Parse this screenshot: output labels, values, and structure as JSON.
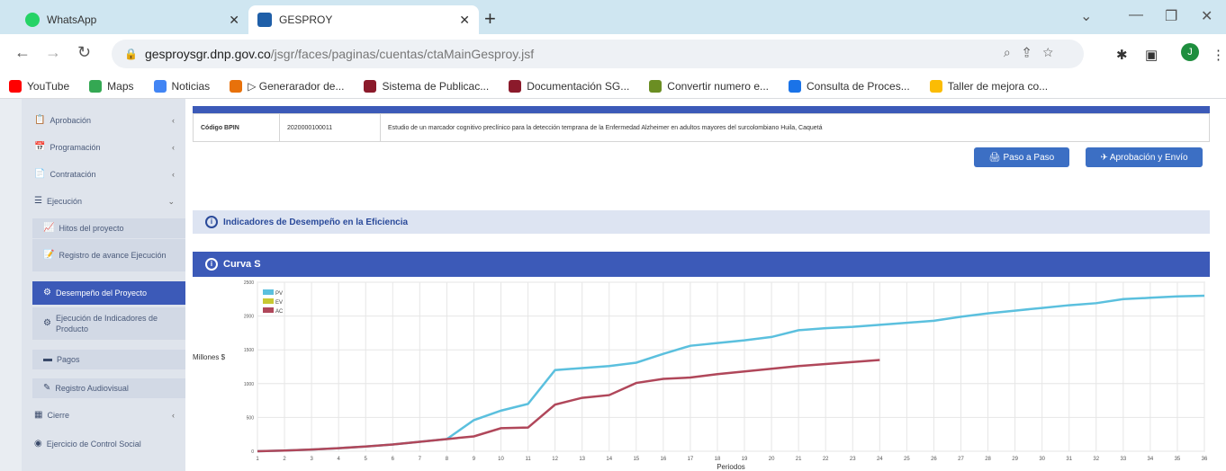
{
  "browser": {
    "tabs": [
      {
        "title": "WhatsApp",
        "color": "#25d366",
        "active": false
      },
      {
        "title": "GESPROY",
        "color": "#1f5fa8",
        "active": true
      }
    ],
    "new_tab": "+",
    "url_host": "gesproysgr.dnp.gov.co",
    "url_path": "/jsgr/faces/paginas/cuentas/ctaMainGesproy.jsf",
    "profile_initial": "J",
    "bookmarks": [
      {
        "label": "YouTube",
        "color": "#ff0000"
      },
      {
        "label": "Maps",
        "color": "#34a853"
      },
      {
        "label": "Noticias",
        "color": "#4285f4"
      },
      {
        "label": "▷ Generarador de...",
        "color": "#e8710a"
      },
      {
        "label": "Sistema de Publicac...",
        "color": "#8b1a2b"
      },
      {
        "label": "Documentación SG...",
        "color": "#8b1a2b"
      },
      {
        "label": "Convertir numero e...",
        "color": "#6b8e23"
      },
      {
        "label": "Consulta de Proces...",
        "color": "#1a73e8"
      },
      {
        "label": "Taller de mejora co...",
        "color": "#fbbc04"
      }
    ]
  },
  "sidebar": {
    "items": [
      {
        "label": "Aprobación",
        "icon": "📋",
        "chev": "‹"
      },
      {
        "label": "Programación",
        "icon": "📅",
        "chev": "‹"
      },
      {
        "label": "Contratación",
        "icon": "📄",
        "chev": "‹"
      },
      {
        "label": "Ejecución",
        "icon": "☰",
        "chev": "⌄"
      },
      {
        "label": "Hitos del proyecto",
        "icon": "📈",
        "sub": true
      },
      {
        "label": "Registro de avance Ejecución",
        "icon": "📝",
        "sub": true
      },
      {
        "label": "Desempeño del Proyecto",
        "icon": "⚙",
        "sub": true,
        "selected": true
      },
      {
        "label": "Ejecución de Indicadores de Producto",
        "icon": "⚙",
        "sub": true
      },
      {
        "label": "Pagos",
        "icon": "▬",
        "sub": true
      },
      {
        "label": "Registro Audiovisual",
        "icon": "✎",
        "sub": true
      },
      {
        "label": "Cierre",
        "icon": "▦",
        "chev": "‹"
      },
      {
        "label": "Ejercicio de Control Social",
        "icon": "◉"
      }
    ]
  },
  "project": {
    "bpin_label": "Código BPIN",
    "bpin_value": "2020000100011",
    "description": "Estudio de un marcador cognitivo preclínico para la detección temprana de la Enfermedad Alzheimer en adultos mayores del surcolombiano Huila, Caquetá"
  },
  "buttons": {
    "paso_a_paso": "Paso a Paso",
    "aprobacion_envio": "Aprobación y Envío"
  },
  "panels": {
    "indicadores": "Indicadores de Desempeño en la Eficiencia",
    "curva": "Curva S"
  },
  "colors": {
    "pv": "#5bc0de",
    "ev": "#c8c832",
    "ac": "#b0475a",
    "brand": "#3c5ab8"
  },
  "chart_data": {
    "type": "line",
    "xlabel": "Periodos",
    "ylabel": "Millones $",
    "ylim": [
      0,
      2500
    ],
    "yticks": [
      0,
      500,
      1000,
      1500,
      2000,
      2500
    ],
    "x": [
      1,
      2,
      3,
      4,
      5,
      6,
      7,
      8,
      9,
      10,
      11,
      12,
      13,
      14,
      15,
      16,
      17,
      18,
      19,
      20,
      21,
      22,
      23,
      24,
      25,
      26,
      27,
      28,
      29,
      30,
      31,
      32,
      33,
      34,
      35,
      36
    ],
    "legend_position": "top-left",
    "grid": true,
    "series": [
      {
        "name": "PV",
        "color": "#5bc0de",
        "values": [
          0,
          10,
          25,
          45,
          70,
          100,
          140,
          180,
          460,
          600,
          700,
          1200,
          1230,
          1260,
          1310,
          1440,
          1560,
          1600,
          1640,
          1690,
          1790,
          1820,
          1840,
          1870,
          1900,
          1930,
          1990,
          2040,
          2080,
          2120,
          2160,
          2190,
          2250,
          2270,
          2290,
          2300
        ]
      },
      {
        "name": "EV",
        "color": "#c8c832",
        "values": []
      },
      {
        "name": "AC",
        "color": "#b0475a",
        "values": [
          0,
          10,
          25,
          45,
          70,
          100,
          140,
          180,
          220,
          340,
          350,
          690,
          790,
          830,
          1010,
          1070,
          1090,
          1140,
          1180,
          1220,
          1260,
          1290,
          1320,
          1350
        ]
      }
    ]
  }
}
